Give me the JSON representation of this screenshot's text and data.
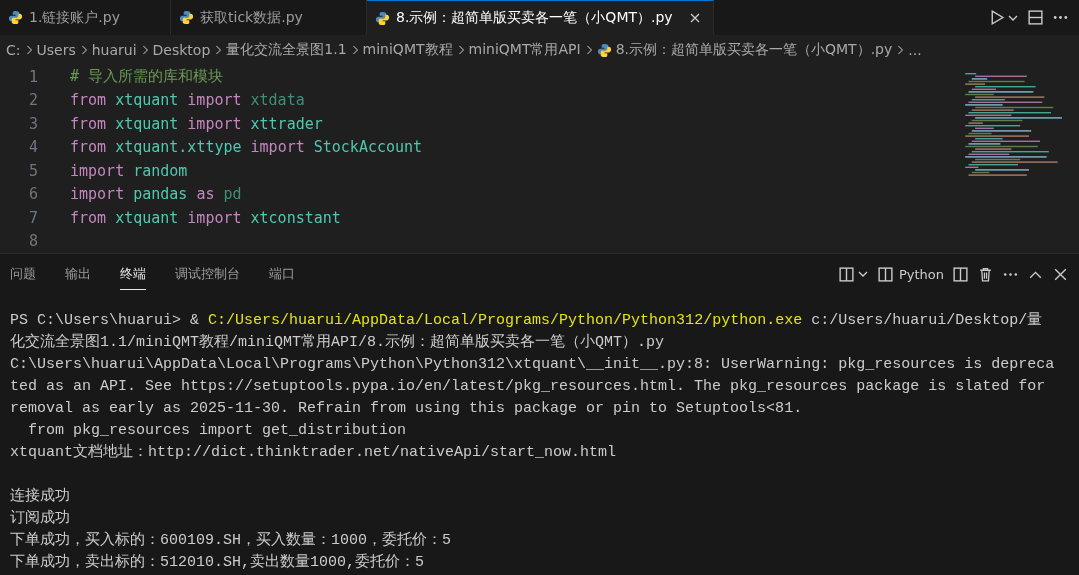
{
  "tabs": [
    {
      "label": "1.链接账户.py",
      "selected": false
    },
    {
      "label": "获取tick数据.py",
      "selected": false
    },
    {
      "label": "8.示例：超简单版买卖各一笔（小QMT）.py",
      "selected": true
    }
  ],
  "breadcrumbs": [
    "C:",
    "Users",
    "huarui",
    "Desktop",
    "量化交流全景图1.1",
    "miniQMT教程",
    "miniQMT常用API",
    "8.示例：超简单版买卖各一笔（小QMT）.py",
    "..."
  ],
  "editor": {
    "lines": [
      {
        "number": "1",
        "tokens": [
          {
            "kind": "comment",
            "text": "# 导入所需的库和模块"
          }
        ]
      },
      {
        "number": "2",
        "tokens": [
          {
            "kind": "keyword",
            "text": "from"
          },
          {
            "kind": "module",
            "text": "xtquant"
          },
          {
            "kind": "keyword",
            "text": "import"
          },
          {
            "kind": "unused",
            "text": "xtdata"
          }
        ]
      },
      {
        "number": "3",
        "tokens": [
          {
            "kind": "keyword",
            "text": "from"
          },
          {
            "kind": "module",
            "text": "xtquant"
          },
          {
            "kind": "keyword",
            "text": "import"
          },
          {
            "kind": "module",
            "text": "xttrader"
          }
        ]
      },
      {
        "number": "4",
        "tokens": [
          {
            "kind": "keyword",
            "text": "from"
          },
          {
            "kind": "module",
            "text": "xtquant.xttype"
          },
          {
            "kind": "keyword",
            "text": "import"
          },
          {
            "kind": "module",
            "text": "StockAccount"
          }
        ]
      },
      {
        "number": "5",
        "tokens": [
          {
            "kind": "keyword",
            "text": "import"
          },
          {
            "kind": "module",
            "text": "random"
          }
        ]
      },
      {
        "number": "6",
        "tokens": [
          {
            "kind": "keyword",
            "text": "import"
          },
          {
            "kind": "module",
            "text": "pandas"
          },
          {
            "kind": "keyword",
            "text": "as"
          },
          {
            "kind": "unused",
            "text": "pd"
          }
        ]
      },
      {
        "number": "7",
        "tokens": [
          {
            "kind": "keyword",
            "text": "from"
          },
          {
            "kind": "module",
            "text": "xtquant"
          },
          {
            "kind": "keyword",
            "text": "import"
          },
          {
            "kind": "module",
            "text": "xtconstant"
          }
        ]
      },
      {
        "number": "8"
      }
    ]
  },
  "panel": {
    "tabs": [
      {
        "label": "问题",
        "selected": false
      },
      {
        "label": "输出",
        "selected": false
      },
      {
        "label": "终端",
        "selected": true
      },
      {
        "label": "调试控制台",
        "selected": false
      },
      {
        "label": "端口",
        "selected": false
      }
    ],
    "shell": "Python"
  },
  "terminal": [
    {
      "lines": [
        [
          {
            "kind": "plain",
            "text": "PS C:\\Users\\huarui> & "
          },
          {
            "kind": "path",
            "text": "C:/Users/huarui/AppData/Local/Programs/Python/Python312/python.exe"
          },
          {
            "kind": "plain",
            "text": " c:/Users/huarui/Desktop/量"
          }
        ],
        [
          {
            "kind": "plain",
            "text": "化交流全景图1.1/miniQMT教程/miniQMT常用API/8.示例：超简单版买卖各一笔（小QMT）.py"
          }
        ],
        [
          {
            "kind": "plain",
            "text": "C:\\Users\\huarui\\AppData\\Local\\Programs\\Python\\Python312\\xtquant\\__init__.py:8: UserWarning: pkg_resources is depreca"
          }
        ],
        [
          {
            "kind": "plain",
            "text": "ted as an API. See https://setuptools.pypa.io/en/latest/pkg_resources.html. The pkg_resources package is slated for"
          }
        ],
        [
          {
            "kind": "plain",
            "text": "removal as early as 2025-11-30. Refrain from using this package or pin to Setuptools<81."
          }
        ],
        [
          {
            "kind": "plain",
            "text": "  from pkg_resources import get_distribution"
          }
        ],
        [
          {
            "kind": "plain",
            "text": "xtquant文档地址：http://dict.thinktrader.net/nativeApi/start_now.html"
          }
        ]
      ]
    },
    {
      "lines": [
        [
          {
            "kind": "plain",
            "text": "连接成功"
          }
        ],
        [
          {
            "kind": "plain",
            "text": "订阅成功"
          }
        ],
        [
          {
            "kind": "plain",
            "text": "下单成功，买入标的：600109.SH，买入数量：1000，委托价：5"
          }
        ],
        [
          {
            "kind": "plain",
            "text": "下单成功，卖出标的：512010.SH,卖出数量1000,委托价：5"
          }
        ]
      ]
    }
  ]
}
